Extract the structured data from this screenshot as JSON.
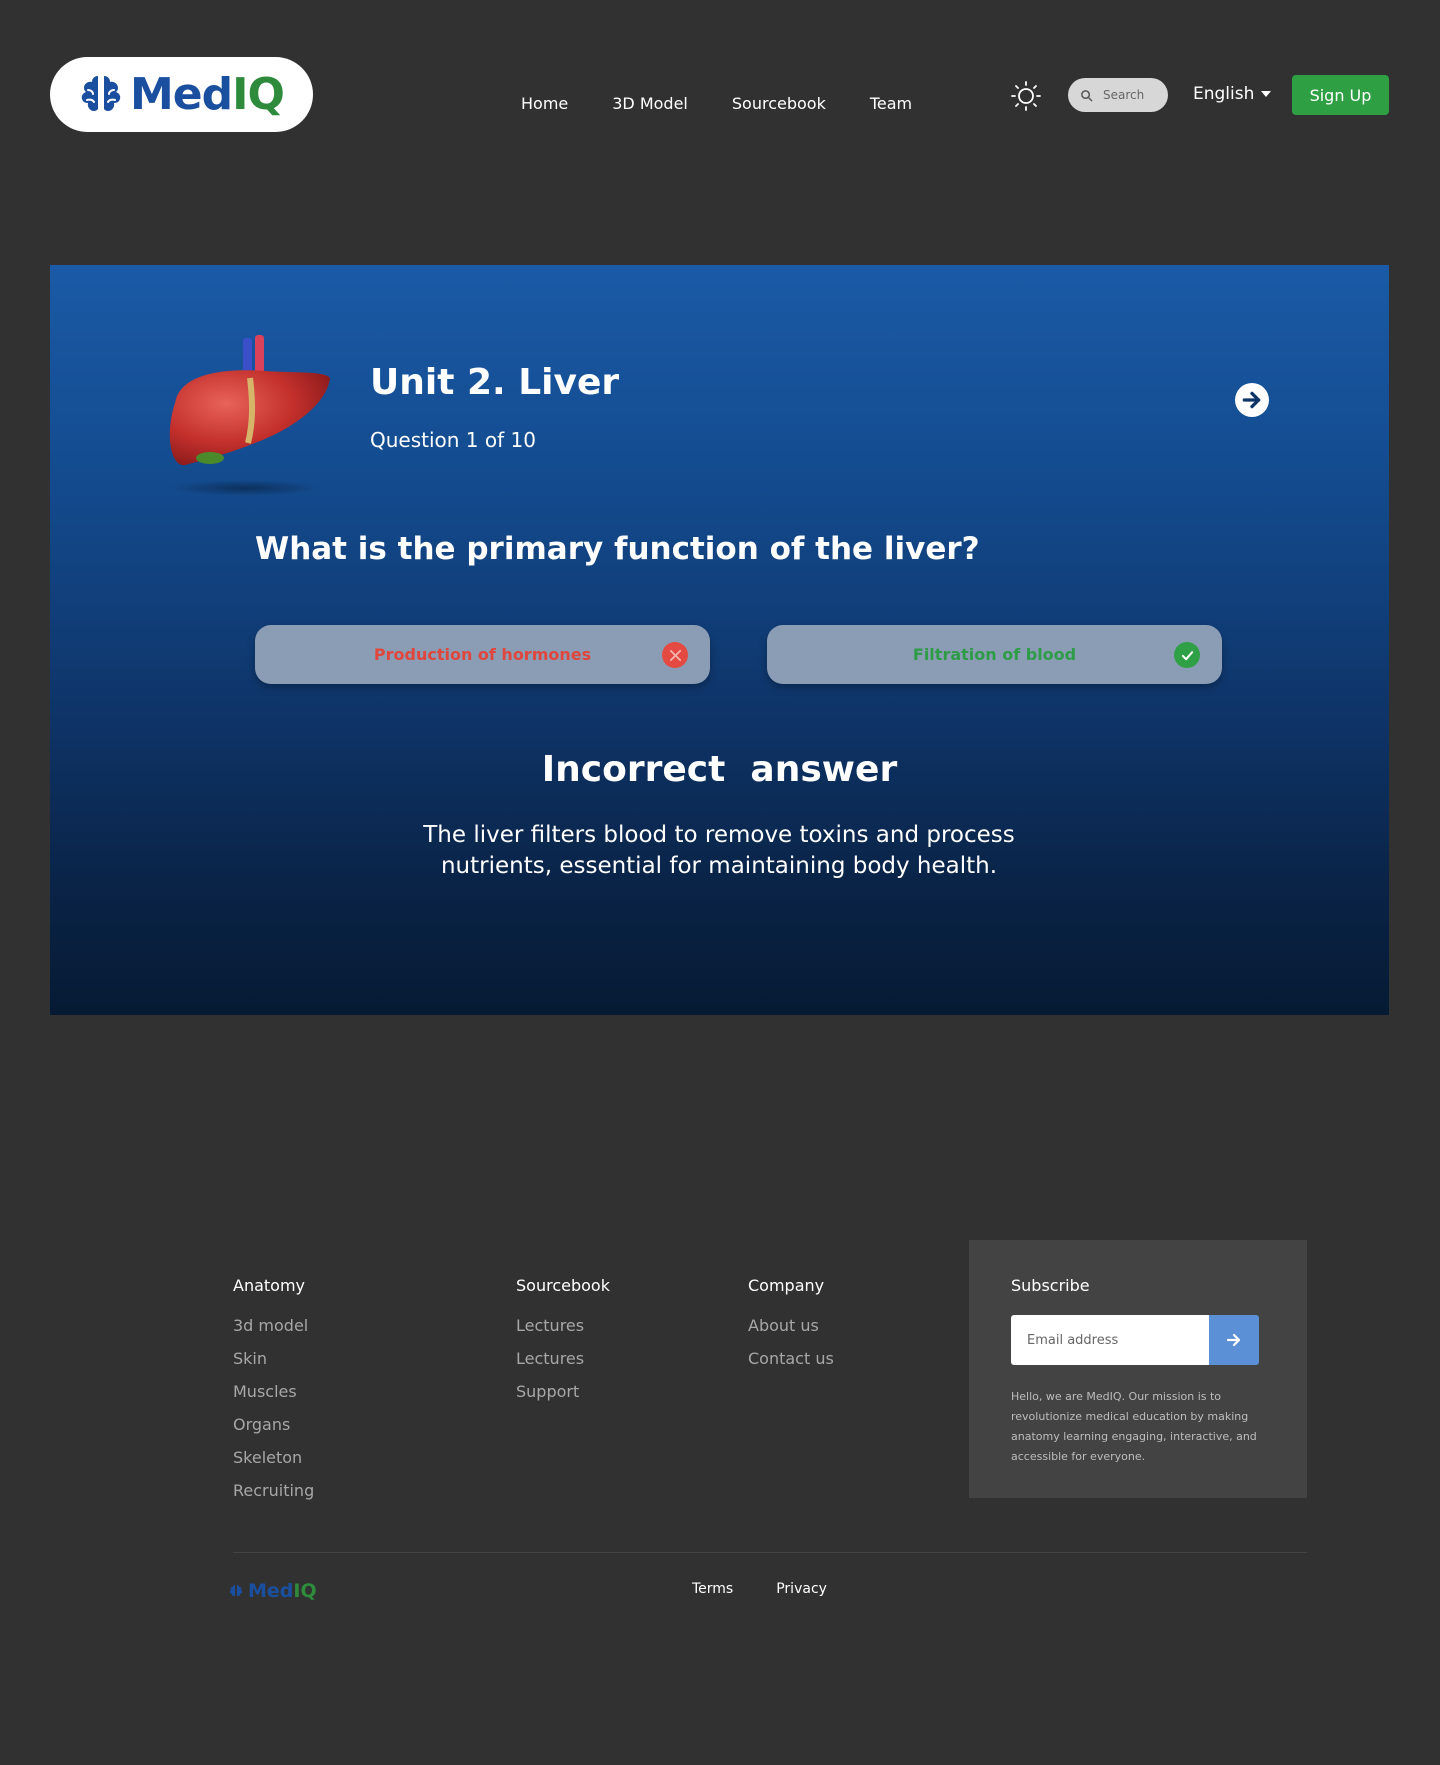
{
  "brand": {
    "name_part1": "Med",
    "name_part2": "IQ",
    "primary_color": "#1a4fa0",
    "secondary_color": "#2e8b3c"
  },
  "nav": {
    "items": [
      "Home",
      "3D Model",
      "Sourcebook",
      "Team"
    ]
  },
  "header": {
    "search_placeholder": "Search",
    "language": "English",
    "signup_label": "Sign Up",
    "theme_icon": "sun-icon"
  },
  "quiz": {
    "unit_title": "Unit 2. Liver",
    "question_count": "Question 1 of 10",
    "question": "What is the primary function of the liver?",
    "answers": [
      {
        "label": "Production of hormones",
        "status": "incorrect",
        "icon": "x-circle-icon"
      },
      {
        "label": "Filtration of blood",
        "status": "correct",
        "icon": "check-circle-icon"
      }
    ],
    "result_title": "Incorrect  answer",
    "explanation": "The liver filters blood to remove toxins and process nutrients, essential for maintaining body health.",
    "next_icon": "arrow-right-circle-icon",
    "colors": {
      "incorrect": "#e0463c",
      "correct": "#2e9c46"
    }
  },
  "footer": {
    "anatomy": {
      "title": "Anatomy",
      "links": [
        "3d model",
        "Skin",
        "Muscles",
        "Organs",
        "Skeleton",
        "Recruiting"
      ]
    },
    "sourcebook": {
      "title": "Sourcebook",
      "links": [
        "Lectures",
        "Lectures",
        "Support"
      ]
    },
    "company": {
      "title": "Company",
      "links": [
        "About us",
        "Contact us"
      ]
    },
    "subscribe": {
      "title": "Subscribe",
      "email_placeholder": "Email address",
      "text": "Hello, we are MedIQ. Our mission is to revolutionize medical education by making anatomy learning engaging, interactive, and accessible for everyone."
    },
    "bottom_links": [
      "Terms",
      "Privacy"
    ]
  }
}
